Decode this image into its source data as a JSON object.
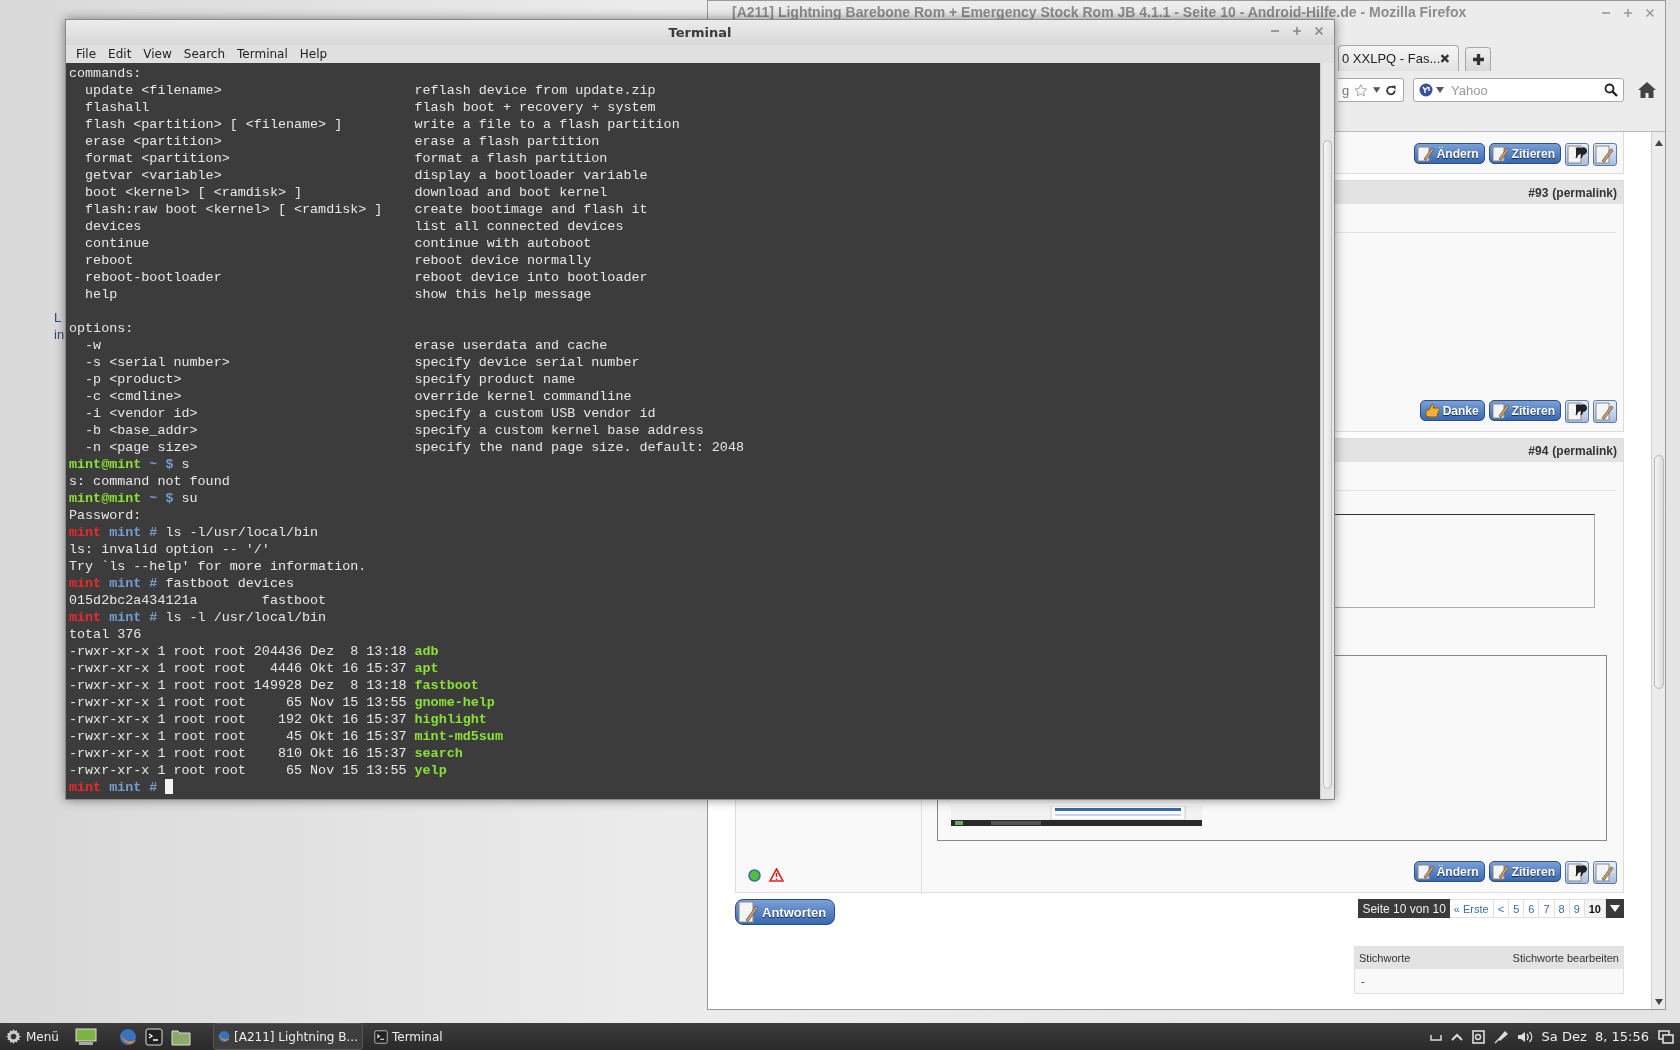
{
  "desktop": {
    "icon_label": [
      "L",
      "in"
    ]
  },
  "browser": {
    "title": "[A211] Lightning Barebone Rom + Emergency Stock Rom JB 4.1.1 - Seite 10 - Android-Hilfe.de - Mozilla Firefox",
    "tab": {
      "label": "0 XXLPQ - Fas..."
    },
    "address_fragment": "g",
    "search": {
      "placeholder": "Yahoo"
    },
    "top_buttons": [
      {
        "kind": "edit",
        "label": "Ändern"
      },
      {
        "kind": "quote",
        "label": "Zitieren"
      },
      {
        "kind": "multiquote"
      },
      {
        "kind": "reply"
      }
    ],
    "posts": [
      {
        "kind": "text",
        "number": "#93",
        "permalink": "(permalink)",
        "buttons": [
          {
            "kind": "thanks",
            "label": "Danke"
          },
          {
            "kind": "quote",
            "label": "Zitieren"
          },
          {
            "kind": "multiquote"
          },
          {
            "kind": "reply"
          }
        ]
      },
      {
        "kind": "with_image",
        "number": "#94",
        "permalink": "(permalink)",
        "buttons": [
          {
            "kind": "edit",
            "label": "Ändern"
          },
          {
            "kind": "quote",
            "label": "Zitieren"
          },
          {
            "kind": "multiquote"
          },
          {
            "kind": "reply"
          }
        ]
      }
    ],
    "reply_button": "Antworten",
    "pagination": {
      "label": "Seite 10 von 10",
      "items": [
        {
          "label": "« Erste",
          "selected": false
        },
        {
          "label": "<",
          "selected": false
        },
        {
          "label": "5",
          "selected": false
        },
        {
          "label": "6",
          "selected": false
        },
        {
          "label": "7",
          "selected": false
        },
        {
          "label": "8",
          "selected": false
        },
        {
          "label": "9",
          "selected": false
        },
        {
          "label": "10",
          "selected": true
        }
      ]
    },
    "tags": {
      "title": "Stichworte",
      "edit": "Stichworte bearbeiten",
      "value": "-"
    }
  },
  "terminal": {
    "title": "Terminal",
    "menu": [
      "File",
      "Edit",
      "View",
      "Search",
      "Terminal",
      "Help"
    ],
    "lines": [
      {
        "kind": "text",
        "text": "commands:"
      },
      {
        "kind": "help",
        "option": "update <filename>",
        "description": "reflash device from update.zip"
      },
      {
        "kind": "help",
        "option": "flashall",
        "description": "flash boot + recovery + system"
      },
      {
        "kind": "help",
        "option": "flash <partition> [ <filename> ]",
        "description": "write a file to a flash partition"
      },
      {
        "kind": "help",
        "option": "erase <partition>",
        "description": "erase a flash partition"
      },
      {
        "kind": "help",
        "option": "format <partition>",
        "description": "format a flash partition"
      },
      {
        "kind": "help",
        "option": "getvar <variable>",
        "description": "display a bootloader variable"
      },
      {
        "kind": "help",
        "option": "boot <kernel> [ <ramdisk> ]",
        "description": "download and boot kernel"
      },
      {
        "kind": "help",
        "option": "flash:raw boot <kernel> [ <ramdisk> ]",
        "description": "create bootimage and flash it"
      },
      {
        "kind": "help",
        "option": "devices",
        "description": "list all connected devices"
      },
      {
        "kind": "help",
        "option": "continue",
        "description": "continue with autoboot"
      },
      {
        "kind": "help",
        "option": "reboot",
        "description": "reboot device normally"
      },
      {
        "kind": "help",
        "option": "reboot-bootloader",
        "description": "reboot device into bootloader"
      },
      {
        "kind": "help",
        "option": "help",
        "description": "show this help message"
      },
      {
        "kind": "blank"
      },
      {
        "kind": "text",
        "text": "options:"
      },
      {
        "kind": "help",
        "option": "-w",
        "description": "erase userdata and cache"
      },
      {
        "kind": "help",
        "option": "-s <serial number>",
        "description": "specify device serial number"
      },
      {
        "kind": "help",
        "option": "-p <product>",
        "description": "specify product name"
      },
      {
        "kind": "help",
        "option": "-c <cmdline>",
        "description": "override kernel commandline"
      },
      {
        "kind": "help",
        "option": "-i <vendor id>",
        "description": "specify a custom USB vendor id"
      },
      {
        "kind": "help",
        "option": "-b <base_addr>",
        "description": "specify a custom kernel base address"
      },
      {
        "kind": "help",
        "option": "-n <page size>",
        "description": "specify the nand page size. default: 2048"
      },
      {
        "kind": "prompt",
        "user": "mint@mint",
        "path": "~ $",
        "command": "s"
      },
      {
        "kind": "text",
        "text": "s: command not found"
      },
      {
        "kind": "prompt",
        "user": "mint@mint",
        "path": "~ $",
        "command": "su"
      },
      {
        "kind": "text",
        "text": "Password:"
      },
      {
        "kind": "root_prompt",
        "user": "mint",
        "path": "mint #",
        "command": "ls -l/usr/local/bin"
      },
      {
        "kind": "text",
        "text": "ls: invalid option -- '/'"
      },
      {
        "kind": "text",
        "text": "Try `ls --help' for more information."
      },
      {
        "kind": "root_prompt",
        "user": "mint",
        "path": "mint #",
        "command": "fastboot devices"
      },
      {
        "kind": "text",
        "text": "015d2bc2a434121a        fastboot"
      },
      {
        "kind": "root_prompt",
        "user": "mint",
        "path": "mint #",
        "command": "ls -l /usr/local/bin"
      },
      {
        "kind": "text",
        "text": "total 376"
      },
      {
        "kind": "listing",
        "text": "-rwxr-xr-x 1 root root 204436 Dez  8 13:18",
        "name": "adb"
      },
      {
        "kind": "listing",
        "text": "-rwxr-xr-x 1 root root   4446 Okt 16 15:37",
        "name": "apt"
      },
      {
        "kind": "listing",
        "text": "-rwxr-xr-x 1 root root 149928 Dez  8 13:18",
        "name": "fastboot"
      },
      {
        "kind": "listing",
        "text": "-rwxr-xr-x 1 root root     65 Nov 15 13:55",
        "name": "gnome-help"
      },
      {
        "kind": "listing",
        "text": "-rwxr-xr-x 1 root root    192 Okt 16 15:37",
        "name": "highlight"
      },
      {
        "kind": "listing",
        "text": "-rwxr-xr-x 1 root root     45 Okt 16 15:37",
        "name": "mint-md5sum"
      },
      {
        "kind": "listing",
        "text": "-rwxr-xr-x 1 root root    810 Okt 16 15:37",
        "name": "search"
      },
      {
        "kind": "listing",
        "text": "-rwxr-xr-x 1 root root     65 Nov 15 13:55",
        "name": "yelp"
      },
      {
        "kind": "root_prompt",
        "user": "mint",
        "path": "mint #",
        "cursor": true
      }
    ]
  },
  "taskbar": {
    "menu": "Menü",
    "windows": [
      {
        "label": "[A211] Lightning B...",
        "kind": "browser",
        "selected": true
      },
      {
        "label": "Terminal",
        "kind": "terminal",
        "selected": false
      }
    ],
    "clock": "Sa Dez  8, 15:56"
  }
}
